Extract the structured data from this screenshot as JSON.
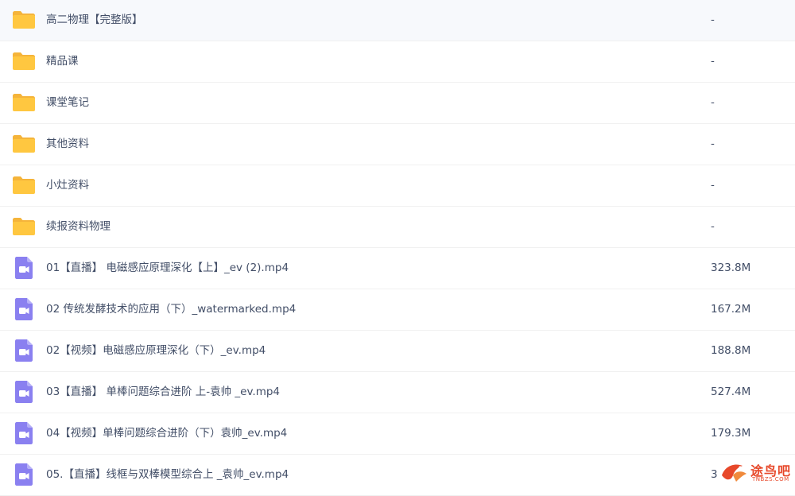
{
  "files": [
    {
      "name": "高二物理【完整版】",
      "size": "-",
      "type": "folder",
      "icon": "folder-icon"
    },
    {
      "name": "精品课",
      "size": "-",
      "type": "folder",
      "icon": "folder-icon"
    },
    {
      "name": "课堂笔记",
      "size": "-",
      "type": "folder",
      "icon": "folder-icon"
    },
    {
      "name": "其他资料",
      "size": "-",
      "type": "folder",
      "icon": "folder-icon"
    },
    {
      "name": "小灶资料",
      "size": "-",
      "type": "folder",
      "icon": "folder-icon"
    },
    {
      "name": "续报资料物理",
      "size": "-",
      "type": "folder",
      "icon": "folder-icon"
    },
    {
      "name": "01【直播】 电磁感应原理深化【上】_ev (2).mp4",
      "size": "323.8M",
      "type": "video",
      "icon": "video-file-icon"
    },
    {
      "name": "02 传统发酵技术的应用（下）_watermarked.mp4",
      "size": "167.2M",
      "type": "video",
      "icon": "video-file-icon"
    },
    {
      "name": "02【视频】电磁感应原理深化（下）_ev.mp4",
      "size": "188.8M",
      "type": "video",
      "icon": "video-file-icon"
    },
    {
      "name": "03【直播】 单棒问题综合进阶 上-袁帅 _ev.mp4",
      "size": "527.4M",
      "type": "video",
      "icon": "video-file-icon"
    },
    {
      "name": "04【视频】单棒问题综合进阶（下）袁帅_ev.mp4",
      "size": "179.3M",
      "type": "video",
      "icon": "video-file-icon"
    },
    {
      "name": "05.【直播】线框与双棒模型综合上 _袁帅_ev.mp4",
      "size": "3",
      "type": "video",
      "icon": "video-file-icon"
    }
  ],
  "watermark": {
    "text": "途鸟吧",
    "subtext": "TNBZS.COM",
    "color": "#e7482a"
  },
  "colors": {
    "folder": "#ffc740",
    "folder_tab": "#f5b43a",
    "video": "#8a80f0",
    "text": "#424e67",
    "divider": "#f0f0f0"
  }
}
